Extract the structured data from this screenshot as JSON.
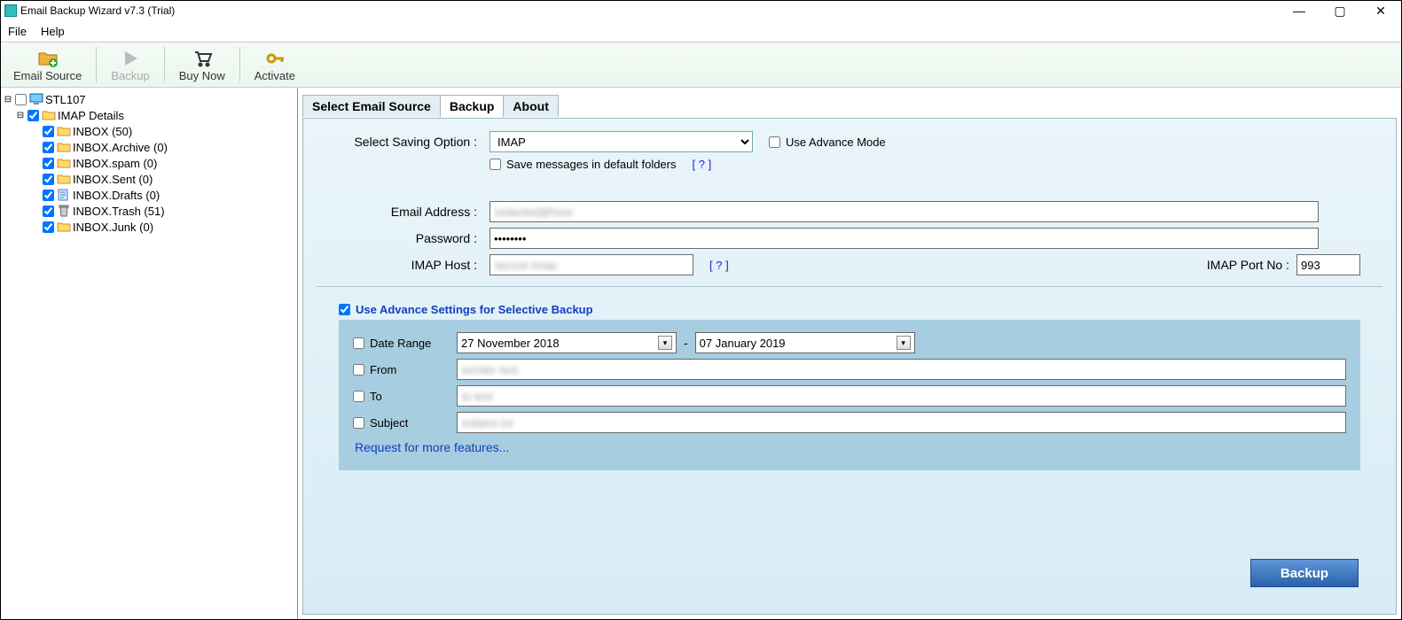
{
  "window": {
    "title": "Email Backup Wizard v7.3 (Trial)",
    "min": "—",
    "max": "▢",
    "close": "✕"
  },
  "menu": {
    "file": "File",
    "help": "Help"
  },
  "toolbar": {
    "email_source": "Email Source",
    "backup": "Backup",
    "buy_now": "Buy Now",
    "activate": "Activate"
  },
  "tree": {
    "root": "STL107",
    "imap": "IMAP Details",
    "items": [
      "INBOX (50)",
      "INBOX.Archive (0)",
      "INBOX.spam (0)",
      "INBOX.Sent (0)",
      "INBOX.Drafts (0)",
      "INBOX.Trash (51)",
      "INBOX.Junk (0)"
    ]
  },
  "tabs": {
    "select_source": "Select Email Source",
    "backup": "Backup",
    "about": "About"
  },
  "form": {
    "saving_label": "Select Saving Option :",
    "saving_value": "IMAP",
    "advance_mode": "Use Advance Mode",
    "save_default": "Save messages in default folders",
    "help": "[ ? ]",
    "email_label": "Email Address :",
    "email_value": "redacted@host",
    "password_label": "Password :",
    "password_value": "••••••••",
    "imap_host_label": "IMAP Host :",
    "imap_host_value": "secure.imap",
    "imap_port_label": "IMAP Port No :",
    "imap_port_value": "993",
    "advance_settings_label": "Use Advance Settings for Selective Backup",
    "date_range_label": "Date Range",
    "date_from": "27  November  2018",
    "date_sep": "-",
    "date_to": "07   January    2019",
    "from_label": "From",
    "from_value": "sender text",
    "to_label": "To",
    "to_value": "to text",
    "subject_label": "Subject",
    "subject_value": "subject txt",
    "more_features": "Request for more features...",
    "backup_button": "Backup"
  }
}
